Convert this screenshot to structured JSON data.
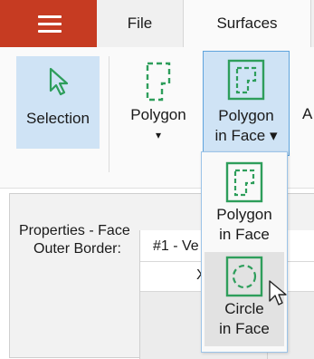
{
  "tabs": {
    "file": "File",
    "surfaces": "Surfaces"
  },
  "ribbon": {
    "selection_label": "Selection",
    "polygon_label": "Polygon",
    "polygon_dropdown_glyph": "▾",
    "polygon_in_face_line1": "Polygon",
    "polygon_in_face_line2": "in Face ▾",
    "cutoff_label": "A"
  },
  "properties": {
    "title": "Properties - Face",
    "outer_border_label": "Outer Border:",
    "outer_border_value": "#1 - Ve",
    "column_x": "X"
  },
  "menu": {
    "items": [
      {
        "line1": "Polygon",
        "line2": "in Face"
      },
      {
        "line1": "Circle",
        "line2": "in Face"
      }
    ]
  },
  "colors": {
    "accent_green": "#2e9e5b",
    "hamburger_red": "#c63b22",
    "selection_blue": "#cfe3f5"
  }
}
